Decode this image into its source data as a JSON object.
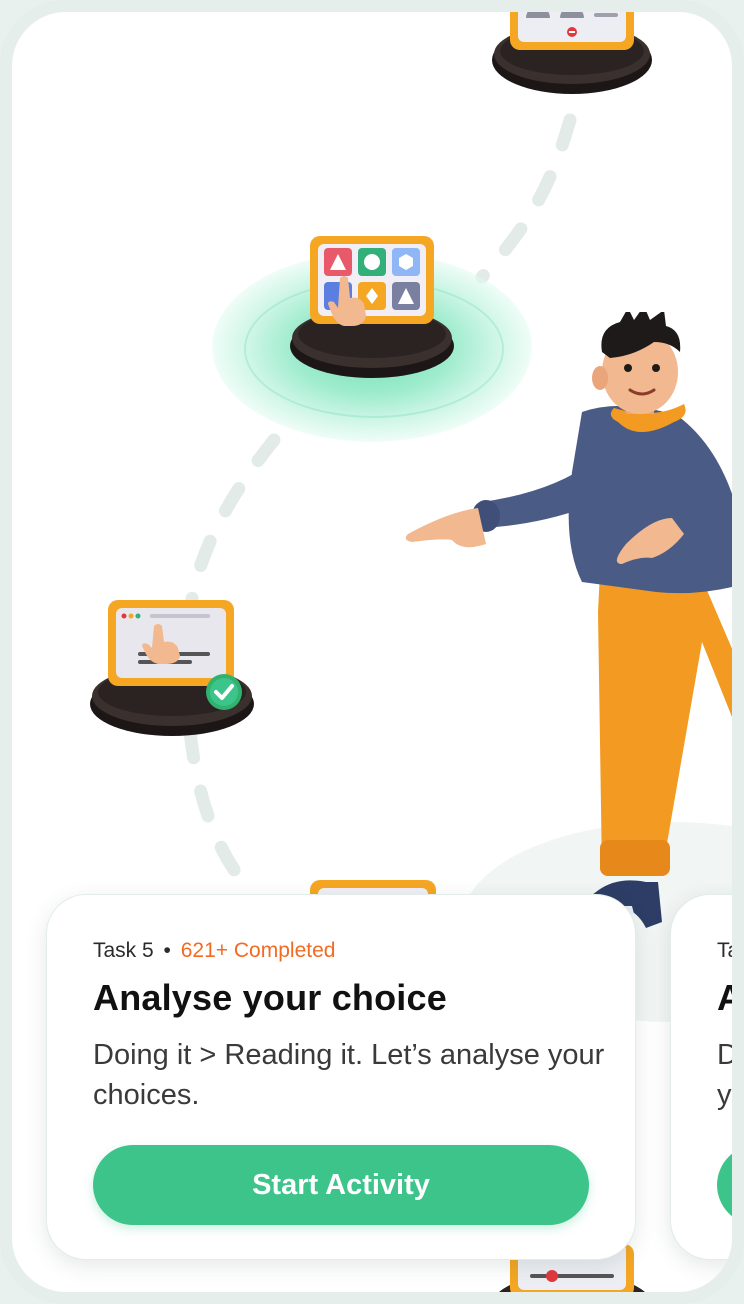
{
  "journey": {
    "nodes": [
      {
        "name": "completed-task-node",
        "icon": "browser-tap-icon",
        "status": "completed"
      },
      {
        "name": "current-task-node",
        "icon": "shapes-grid-tap-icon",
        "status": "current"
      },
      {
        "name": "upcoming-task-node-top",
        "icon": "mobile-gallery-icon",
        "status": "locked"
      },
      {
        "name": "upcoming-task-node-bottom",
        "icon": "video-slider-icon",
        "status": "locked"
      }
    ],
    "mascot": "waving-guide-character"
  },
  "cards": [
    {
      "task_label": "Task 5",
      "separator": "•",
      "completed_count": "621+ Completed",
      "title": "Analyse your choice",
      "description": "Doing it > Reading it. Let’s analyse your choices.",
      "button_label": "Start Activity"
    },
    {
      "task_label": "Ta",
      "title": "A",
      "description_line1": "D",
      "description_line2": "y"
    }
  ],
  "colors": {
    "accent_green": "#3cc48a",
    "completed_orange": "#f26b21",
    "frame_orange": "#f5a623",
    "pedestal": "#2a2322"
  }
}
